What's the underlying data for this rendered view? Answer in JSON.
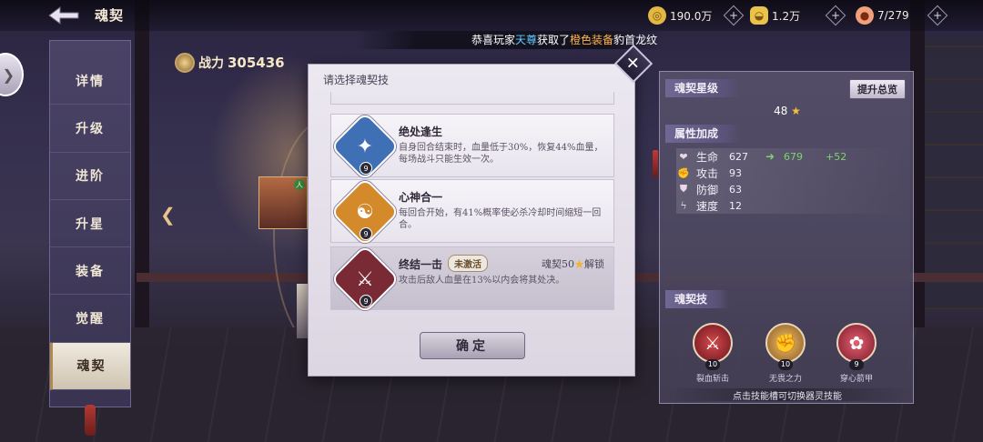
{
  "header": {
    "title": "魂契",
    "resources": [
      {
        "icon": "gold-coin-icon",
        "value": "190.0万",
        "color": "#e3b743"
      },
      {
        "icon": "gold-ingot-icon",
        "value": "1.2万",
        "color": "#e9c24c"
      },
      {
        "icon": "peach-icon",
        "value": "7/279",
        "color": "#f0a07c"
      }
    ]
  },
  "broadcast": {
    "prefix": "恭喜玩家",
    "player": "天尊",
    "middle": "获取了",
    "item": "橙色装备",
    "suffix": "豹首龙纹"
  },
  "sidenav": {
    "tabs": [
      "详情",
      "升级",
      "进阶",
      "升星",
      "装备",
      "觉醒",
      "魂契"
    ],
    "active": 6
  },
  "power": {
    "label": "战力",
    "value": "305436"
  },
  "dialog": {
    "title": "请选择魂契技",
    "confirm": "确定",
    "skills": [
      {
        "name": "绝处逢生",
        "level": "9",
        "desc": "自身回合结束时，血量低于30%，恢复44%血量，每场战斗只能生效一次。",
        "color": "#3f6fb5",
        "glyph": "✦",
        "locked": false
      },
      {
        "name": "心神合一",
        "level": "9",
        "desc": "每回合开始，有41%概率使必杀冷却时间缩短一回合。",
        "color": "#d48a2b",
        "glyph": "☯",
        "locked": false
      },
      {
        "name": "终结一击",
        "level": "9",
        "desc": "攻击后敌人血量在13%以内会将其处决。",
        "state": "未激活",
        "unlock_label": "魂契50",
        "unlock_suffix": "解锁",
        "color": "#7a2a35",
        "glyph": "⚔",
        "locked": true
      }
    ]
  },
  "panel": {
    "star_title": "魂契星级",
    "upgrade_label": "提升总览",
    "star_value": "48",
    "attr_title": "属性加成",
    "attributes": [
      {
        "name": "生命",
        "value": "627",
        "new": "679",
        "diff": "+52",
        "icon": "heart-icon",
        "glyph": "❤"
      },
      {
        "name": "攻击",
        "value": "93",
        "new": "",
        "diff": "",
        "icon": "attack-icon",
        "glyph": "✊"
      },
      {
        "name": "防御",
        "value": "63",
        "new": "",
        "diff": "",
        "icon": "shield-icon",
        "glyph": "⛊"
      },
      {
        "name": "速度",
        "value": "12",
        "new": "",
        "diff": "",
        "icon": "speed-icon",
        "glyph": "ϟ"
      }
    ],
    "skill_title": "魂契技",
    "skills": [
      {
        "name": "裂血斩击",
        "level": "10",
        "color": "#a32b35",
        "glyph": "⚔"
      },
      {
        "name": "无畏之力",
        "level": "10",
        "color": "#c98a35",
        "glyph": "✊"
      },
      {
        "name": "穿心箭甲",
        "level": "9",
        "color": "#b0384a",
        "glyph": "✿"
      }
    ],
    "hint": "点击技能槽可切换器灵技能"
  }
}
